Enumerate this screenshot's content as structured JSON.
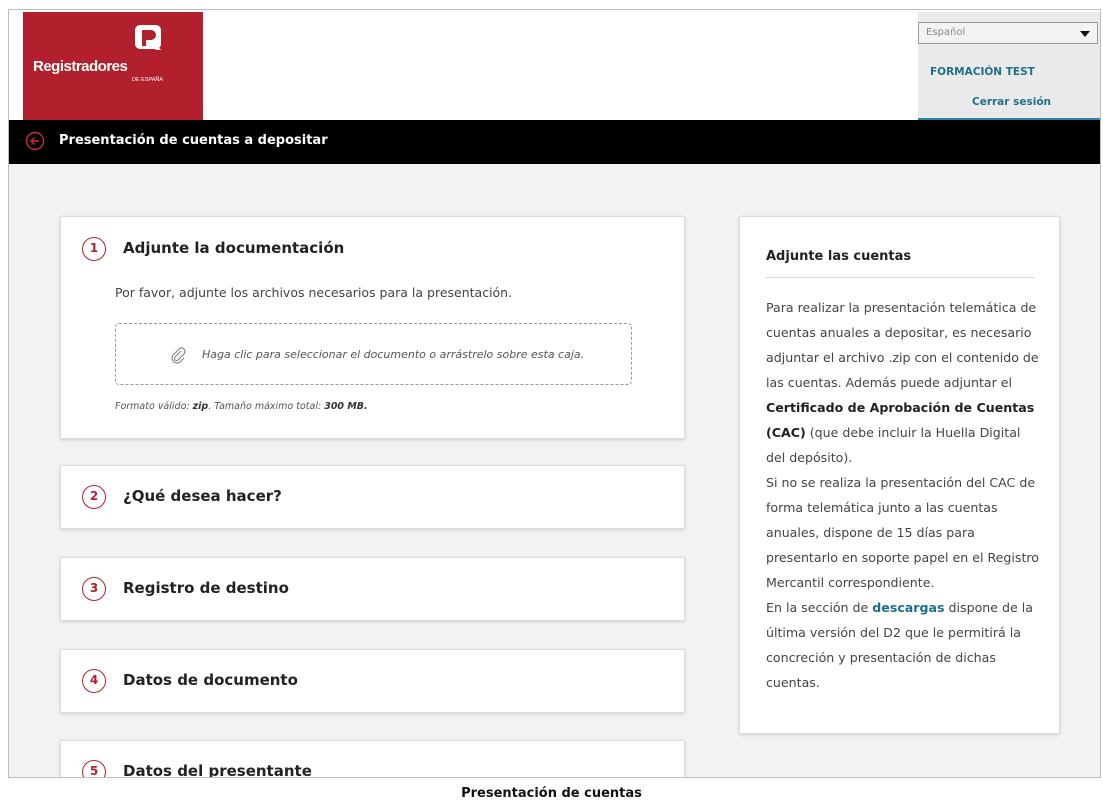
{
  "header": {
    "logo_name": "Registradores",
    "logo_sub": "DE ESPAÑA",
    "language": "Español",
    "user_name": "FORMACIÓN TEST",
    "logout": "Cerrar sesión",
    "brand_color": "#b2202e",
    "link_color": "#1e6f8c"
  },
  "titlebar": {
    "title": "Presentación de cuentas a depositar"
  },
  "steps": [
    {
      "num": "1",
      "title": "Adjunte la documentación"
    },
    {
      "num": "2",
      "title": "¿Qué desea hacer?"
    },
    {
      "num": "3",
      "title": "Registro de destino"
    },
    {
      "num": "4",
      "title": "Datos de documento"
    },
    {
      "num": "5",
      "title": "Datos del presentante"
    }
  ],
  "upload": {
    "description": "Por favor, adjunte los archivos necesarios para la presentación.",
    "dropzone_text": "Haga clic para seleccionar el documento o arrástrelo sobre esta caja.",
    "format_label": "Formato válido:",
    "format_value": "zip",
    "size_label": ". Tamaño máximo total:",
    "size_value": "300 MB."
  },
  "aside": {
    "title": "Adjunte las cuentas",
    "p1_a": "Para realizar la presentación telemática de cuentas anuales a depositar, es necesario adjuntar el archivo .zip con el contenido de las cuentas. Además puede adjuntar el ",
    "p1_bold": "Certificado de Aprobación de Cuentas (CAC)",
    "p1_b": " (que debe incluir la Huella Digital del depósito).",
    "p2": "Si no se realiza la presentación del CAC de forma telemática junto a las cuentas anuales, dispone de 15 días para presentarlo en soporte papel en el Registro Mercantil correspondiente.",
    "p3_a": "En la sección de ",
    "p3_link": "descargas",
    "p3_b": " dispone de la última versión del D2 que le permitirá la concreción y presentación de dichas cuentas."
  },
  "caption": "Presentación de cuentas"
}
